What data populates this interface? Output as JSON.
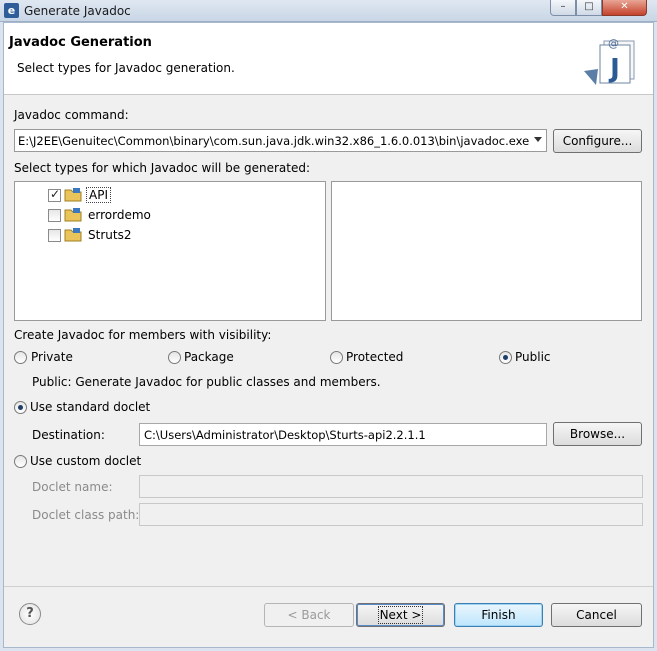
{
  "window": {
    "title": "Generate Javadoc"
  },
  "banner": {
    "heading": "Javadoc Generation",
    "description": "Select types for Javadoc generation."
  },
  "command": {
    "label": "Javadoc command:",
    "value": "E:\\J2EE\\Genuitec\\Common\\binary\\com.sun.java.jdk.win32.x86_1.6.0.013\\bin\\javadoc.exe",
    "configure_label": "Configure..."
  },
  "types": {
    "label": "Select types for which Javadoc will be generated:",
    "projects": [
      {
        "name": "API",
        "checked": true,
        "selected": true
      },
      {
        "name": "errordemo",
        "checked": false,
        "selected": false
      },
      {
        "name": "Struts2",
        "checked": false,
        "selected": false
      }
    ]
  },
  "visibility": {
    "label": "Create Javadoc for members with visibility:",
    "options": [
      "Private",
      "Package",
      "Protected",
      "Public"
    ],
    "selected": "Public",
    "description": "Public: Generate Javadoc for public classes and members."
  },
  "standard_doclet": {
    "label": "Use standard doclet",
    "selected": true,
    "destination_label": "Destination:",
    "destination_value": "C:\\Users\\Administrator\\Desktop\\Sturts-api2.2.1.1",
    "browse_label": "Browse..."
  },
  "custom_doclet": {
    "label": "Use custom doclet",
    "selected": false,
    "name_label": "Doclet name:",
    "name_value": "",
    "class_path_label": "Doclet class path:",
    "class_path_value": ""
  },
  "footer": {
    "back_label": "< Back",
    "next_label": "Next >",
    "finish_label": "Finish",
    "cancel_label": "Cancel"
  },
  "icons": {
    "app": "eclipse-icon",
    "banner": "javadoc-wizard-icon",
    "project": "project-folder-icon",
    "help": "help-icon"
  }
}
